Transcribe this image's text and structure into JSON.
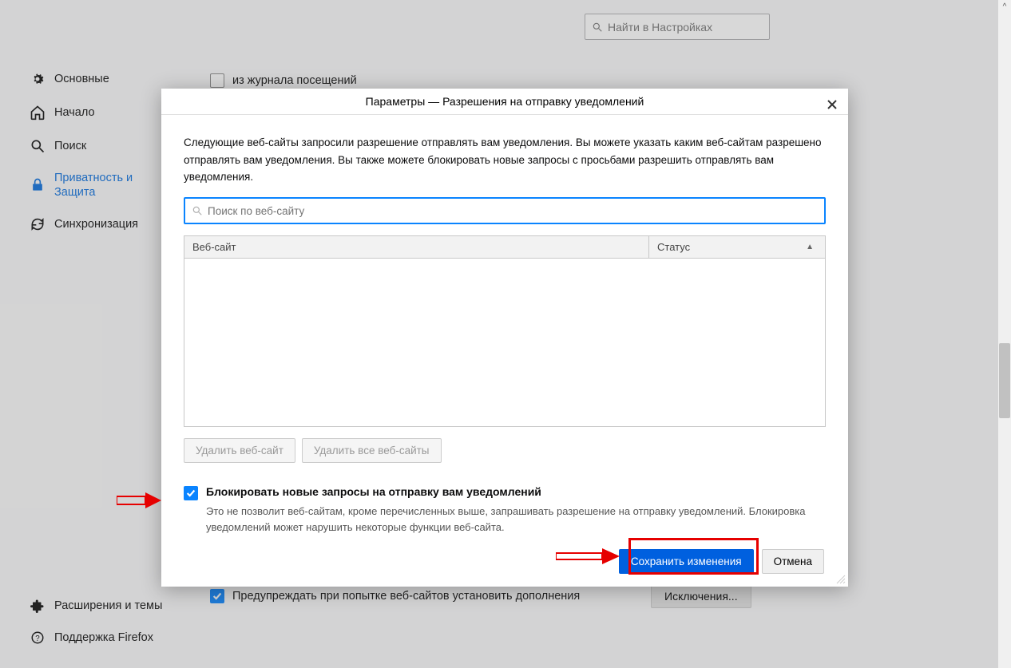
{
  "sidebar": {
    "items": [
      {
        "label": "Основные"
      },
      {
        "label": "Начало"
      },
      {
        "label": "Поиск"
      },
      {
        "label": "Приватность и Защита"
      },
      {
        "label": "Синхронизация"
      }
    ],
    "bottom": [
      {
        "label": "Расширения и темы"
      },
      {
        "label": "Поддержка Firefox"
      }
    ]
  },
  "main": {
    "search_placeholder": "Найти в Настройках",
    "history_row": "из журнала посещений",
    "addons_row": "Предупреждать при попытке веб-сайтов установить дополнения",
    "exceptions_btn": "Исключения..."
  },
  "modal": {
    "title": "Параметры — Разрешения на отправку уведомлений",
    "description": "Следующие веб-сайты запросили разрешение отправлять вам уведомления. Вы можете указать каким веб-сайтам разрешено отправлять вам уведомления. Вы также можете блокировать новые запросы с просьбами разрешить отправлять вам уведомления.",
    "search_placeholder": "Поиск по веб-сайту",
    "col_site": "Веб-сайт",
    "col_status": "Статус",
    "remove_site": "Удалить веб-сайт",
    "remove_all": "Удалить все веб-сайты",
    "block_label": "Блокировать новые запросы на отправку вам уведомлений",
    "block_hint": "Это не позволит веб-сайтам, кроме перечисленных выше, запрашивать разрешение на отправку уведомлений. Блокировка уведомлений может нарушить некоторые функции веб-сайта.",
    "save": "Сохранить изменения",
    "cancel": "Отмена"
  }
}
